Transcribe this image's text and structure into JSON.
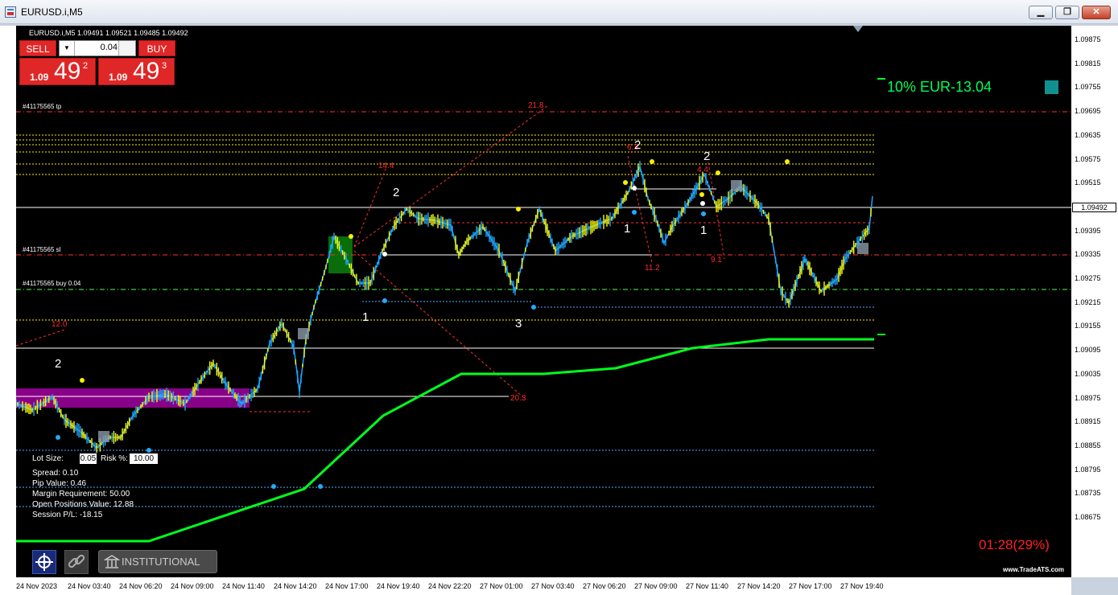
{
  "window": {
    "title": "EURUSD.i,M5",
    "minimize_glyph": "▁",
    "restore_glyph": "❐",
    "close_glyph": "✕"
  },
  "chart_header": "EURUSD.i,M5  1.09491 1.09521 1.09485 1.09492",
  "trade_panel": {
    "sell_label": "SELL",
    "buy_label": "BUY",
    "lot_value": "0.04",
    "sell_price": {
      "small": "1.09",
      "big": "49",
      "sup": "2"
    },
    "buy_price": {
      "small": "1.09",
      "big": "49",
      "sup": "3"
    }
  },
  "order_labels": {
    "tp": "#41175565 tp",
    "sl": "#41175565 sl",
    "buy": "#41175565 buy 0.04"
  },
  "status_text": "10% EUR-13.04",
  "fib_labels": [
    "21.8",
    "14.4",
    "12.0",
    "20.3",
    "11.2",
    "9.1",
    "6.3",
    "4.4"
  ],
  "wave_labels": [
    "2",
    "1",
    "3",
    "2",
    "1",
    "2",
    "1",
    "2"
  ],
  "info_panel": {
    "lot_size_label": "Lot Size:",
    "lot_size_value": "0.05",
    "risk_label": "Risk %:",
    "risk_value": "10.00",
    "spread": "Spread: 0.10",
    "pip_value": "Pip Value: 0.46",
    "margin": "Margin Requirement: 50.00",
    "open_positions": "Open Positions Value: 12.88",
    "session_pl": "Session P/L: -18.15"
  },
  "toolbar": {
    "institutional_label": "INSTITUTIONAL MODE"
  },
  "timer_text": "01:28(29%)",
  "watermark": "www.TradeATS.com",
  "current_price": "1.09492",
  "price_ticks": [
    "1.09875",
    "1.09815",
    "1.09755",
    "1.09695",
    "1.09635",
    "1.09575",
    "1.09515",
    "1.09455",
    "1.09395",
    "1.09335",
    "1.09275",
    "1.09215",
    "1.09155",
    "1.09095",
    "1.09035",
    "1.08975",
    "1.08915",
    "1.08855",
    "1.08795",
    "1.08735",
    "1.08675"
  ],
  "time_ticks": [
    "24 Nov 2023",
    "24 Nov 03:40",
    "24 Nov 06:20",
    "24 Nov 09:00",
    "24 Nov 11:40",
    "24 Nov 14:20",
    "24 Nov 17:00",
    "24 Nov 19:40",
    "24 Nov 22:20",
    "27 Nov 01:00",
    "27 Nov 03:40",
    "27 Nov 06:20",
    "27 Nov 09:00",
    "27 Nov 11:40",
    "27 Nov 14:20",
    "27 Nov 17:00",
    "27 Nov 19:40"
  ],
  "colors": {
    "bull": "#1ea5ff",
    "bear": "#ffff00",
    "ma": "#00ff1e",
    "zone": "#a000a0",
    "status": "#00ff55",
    "timer": "#ff2020"
  }
}
